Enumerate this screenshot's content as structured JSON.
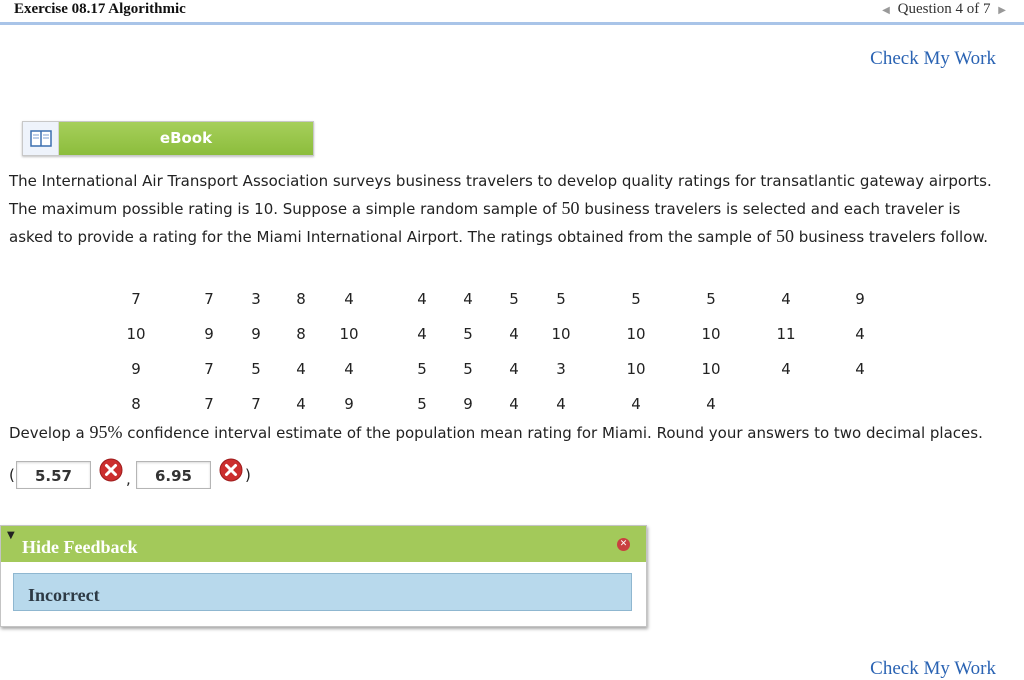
{
  "header": {
    "exercise_title": "Exercise 08.17 Algorithmic",
    "question_nav": "Question 4 of 7"
  },
  "check_my_work": "Check My Work",
  "ebook": {
    "label": "eBook"
  },
  "problem": {
    "part1": "The International Air Transport Association surveys business travelers to develop quality ratings for transatlantic gateway airports. The maximum possible rating is 10. Suppose a simple random sample of ",
    "sample_size_1": "50",
    "part2": " business travelers is selected and each traveler is asked to provide a rating for the Miami International Airport. The ratings obtained from the sample of ",
    "sample_size_2": "50",
    "part3": " business travelers follow."
  },
  "ratings": [
    [
      "7",
      "7",
      "3",
      "8",
      "4",
      "4",
      "4",
      "5",
      "5",
      "5",
      "5",
      "4",
      "9"
    ],
    [
      "10",
      "9",
      "9",
      "8",
      "10",
      "4",
      "5",
      "4",
      "10",
      "10",
      "10",
      "11",
      "4"
    ],
    [
      "9",
      "7",
      "5",
      "4",
      "4",
      "5",
      "5",
      "4",
      "3",
      "10",
      "10",
      "4",
      "4"
    ],
    [
      "8",
      "7",
      "7",
      "4",
      "9",
      "5",
      "9",
      "4",
      "4",
      "4",
      "4",
      "",
      ""
    ]
  ],
  "question": {
    "pre": "Develop a ",
    "confidence": "95%",
    "post": " confidence interval estimate of the population mean rating for Miami. Round your answers to two decimal places."
  },
  "answers": {
    "open_paren": "(",
    "lower": "5.57",
    "separator": ",",
    "upper": "6.95",
    "close_paren": ")",
    "status_icon": "incorrect-x-icon"
  },
  "feedback": {
    "title": "Hide Feedback",
    "result": "Incorrect"
  },
  "colors": {
    "link_blue": "#2a63b3",
    "ebook_green": "#8cbd3c",
    "feedback_green": "#a3c95a",
    "incorrect_bg": "#b8d9ec",
    "error_red": "#cc2e2e"
  }
}
